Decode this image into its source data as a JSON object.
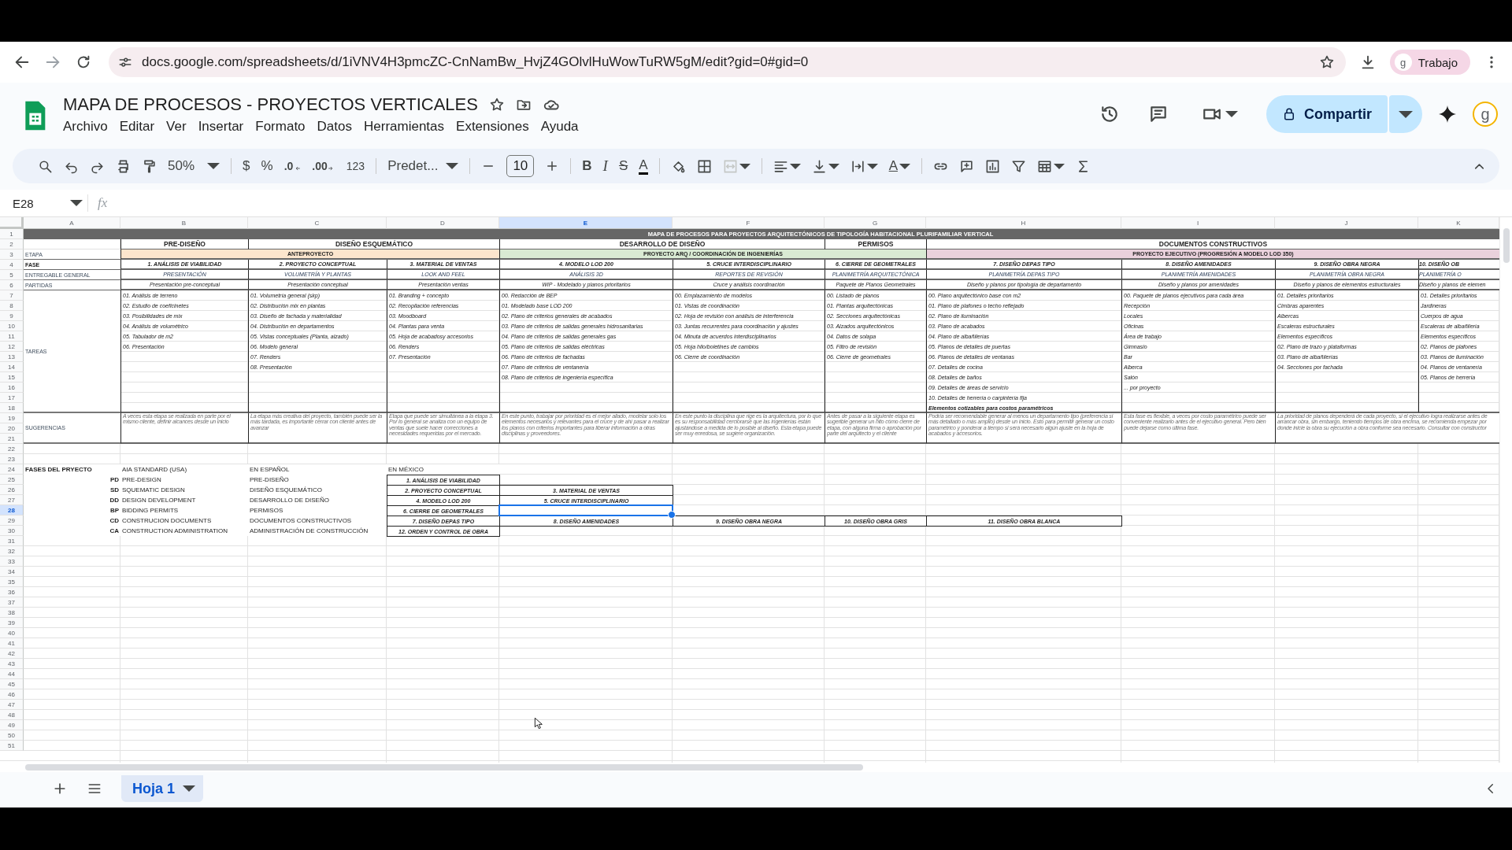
{
  "browser": {
    "url": "docs.google.com/spreadsheets/d/1iVNV4H3pmcZC-CnNamBw_HvjZ4GOlvlHuWowTuRW5gM/edit?gid=0#gid=0",
    "profile_initial": "g",
    "profile": "Trabajo"
  },
  "document": {
    "title": "MAPA DE PROCESOS - PROYECTOS VERTICALES",
    "menu": [
      "Archivo",
      "Editar",
      "Ver",
      "Insertar",
      "Formato",
      "Datos",
      "Herramientas",
      "Extensiones",
      "Ayuda"
    ],
    "share": "Compartir",
    "account_initial": "g"
  },
  "toolbar": {
    "zoom": "50%",
    "currency": "$",
    "percent": "%",
    "decrease_decimals": ".0",
    "increase_decimals": ".00",
    "number_format": "123",
    "font": "Predet...",
    "font_size": "10",
    "bold": "B",
    "italic": "I",
    "strikethrough": "S",
    "text_color": "A",
    "text_rotation": "A"
  },
  "formula_bar": {
    "cell_ref": "E28",
    "fx": "fx"
  },
  "sheet": {
    "columns": [
      {
        "label": "A",
        "selected": false
      },
      {
        "label": "B",
        "selected": false
      },
      {
        "label": "C",
        "selected": false
      },
      {
        "label": "D",
        "selected": false
      },
      {
        "label": "E",
        "selected": true
      },
      {
        "label": "F",
        "selected": false
      },
      {
        "label": "G",
        "selected": false
      },
      {
        "label": "H",
        "selected": false
      },
      {
        "label": "I",
        "selected": false
      },
      {
        "label": "J",
        "selected": false
      },
      {
        "label": "K",
        "selected": false
      }
    ],
    "rows": [
      {
        "label": "1",
        "selected": false
      },
      {
        "label": "2",
        "selected": false
      },
      {
        "label": "3",
        "selected": false
      },
      {
        "label": "4",
        "selected": false
      },
      {
        "label": "5",
        "selected": false
      },
      {
        "label": "6",
        "selected": false
      },
      {
        "label": "7",
        "selected": false
      },
      {
        "label": "8",
        "selected": false
      },
      {
        "label": "9",
        "selected": false
      },
      {
        "label": "10",
        "selected": false
      },
      {
        "label": "11",
        "selected": false
      },
      {
        "label": "12",
        "selected": false
      },
      {
        "label": "13",
        "selected": false
      },
      {
        "label": "14",
        "selected": false
      },
      {
        "label": "15",
        "selected": false
      },
      {
        "label": "16",
        "selected": false
      },
      {
        "label": "17",
        "selected": false
      },
      {
        "label": "18",
        "selected": false
      },
      {
        "label": "19",
        "selected": false
      },
      {
        "label": "20",
        "selected": false
      },
      {
        "label": "21",
        "selected": false
      },
      {
        "label": "22",
        "selected": false
      },
      {
        "label": "23",
        "selected": false
      },
      {
        "label": "24",
        "selected": false
      },
      {
        "label": "25",
        "selected": false
      },
      {
        "label": "26",
        "selected": false
      },
      {
        "label": "27",
        "selected": false
      },
      {
        "label": "28",
        "selected": true
      },
      {
        "label": "29",
        "selected": false
      },
      {
        "label": "30",
        "selected": false
      },
      {
        "label": "31",
        "selected": false
      },
      {
        "label": "32",
        "selected": false
      },
      {
        "label": "33",
        "selected": false
      },
      {
        "label": "34",
        "selected": false
      },
      {
        "label": "35",
        "selected": false
      },
      {
        "label": "36",
        "selected": false
      },
      {
        "label": "37",
        "selected": false
      },
      {
        "label": "38",
        "selected": false
      },
      {
        "label": "39",
        "selected": false
      },
      {
        "label": "40",
        "selected": false
      },
      {
        "label": "41",
        "selected": false
      },
      {
        "label": "42",
        "selected": false
      },
      {
        "label": "43",
        "selected": false
      },
      {
        "label": "44",
        "selected": false
      },
      {
        "label": "45",
        "selected": false
      },
      {
        "label": "46",
        "selected": false
      },
      {
        "label": "47",
        "selected": false
      },
      {
        "label": "48",
        "selected": false
      },
      {
        "label": "49",
        "selected": false
      },
      {
        "label": "50",
        "selected": false
      },
      {
        "label": "51",
        "selected": false
      }
    ],
    "banner": "MAPA DE PROCESOS PARA PROYECTOS ARQUITECTÓNICOS DE TIPOLOGÍA HABITACIONAL PLURIFAMILIAR VERTICAL",
    "row_labels": [
      "ETAPA",
      "FASE",
      "ENTREGABLE GENERAL",
      "PARTIDAS",
      "TAREAS",
      "SUGERENCIAS"
    ],
    "project_stages": [
      {
        "label": "ANTEPROYECTO",
        "color": "#fce5cd",
        "design_stages": [
          {
            "label": "PRE-DISEÑO",
            "phases": [
              {
                "phase": "1. ANÁLISIS DE VIABILIDAD",
                "deliverable": "PRESENTACIÓN",
                "item": "Presentación pre-conceptual",
                "tasks": [
                  "01. Análisis de terreno",
                  "02. Estudio de coeficinetes",
                  "03. Posibilidades de mix",
                  "04. Análisis de volumétrico",
                  "05. Tabulador de m2",
                  "06. Presentación"
                ],
                "suggestion": "A veces esta etapa se realizada en parte por el mismo cliente, definir alcances desde un inicio"
              }
            ]
          },
          {
            "label": "DISEÑO ESQUEMÁTICO",
            "phases": [
              {
                "phase": "2. PROYECTO CONCEPTUAL",
                "deliverable": "VOLUMETRÍA Y PLANTAS",
                "item": "Presentación conceptual",
                "tasks": [
                  "01. Volumetría general (skp)",
                  "02. Distribución mix en plantas",
                  "03. Diseño de fachada y materialidad",
                  "04. Distribución en departamentos",
                  "05. Vistas conceptuales (Planta, alzado)",
                  "06. Modelo general",
                  "07. Renders",
                  "08. Presentación"
                ],
                "suggestion": "La etapa más creativa del proyecto, también puede ser la más tardada, es importante cerrar con cliente antes de avanzar"
              },
              {
                "phase": "3. MATERIAL DE VENTAS",
                "deliverable": "LOOK AND FEEL",
                "item": "Presentación ventas",
                "tasks": [
                  "01. Branding + concepto",
                  "02. Recopilación referencias",
                  "03. Moodboard",
                  "04. Plantas para venta",
                  "05. Hoja de acabadosy accesorios",
                  "06. Renders",
                  "07. Presentación"
                ],
                "suggestion": "Etapa que puede ser simultánea a la etapa 3. Por lo general se analiza con un equipo de ventas que suele hacer correcciones a necesidades requeridas por el mercado."
              }
            ]
          }
        ]
      },
      {
        "label": "PROYECTO ARQ / COORDINACIÓN DE INGENIERÍAS",
        "color": "#d9ead3",
        "design_stages": [
          {
            "label": "DESARROLLO DE DISEÑO",
            "phases": [
              {
                "phase": "4. MODELO LOD 200",
                "deliverable": "ANÁLISIS 3D",
                "item": "WIP - Modelado y planos prioritarios",
                "tasks": [
                  "00. Redacción de BEP",
                  "01. Modelado base LOD 200",
                  "02. Plano de criterios generales de acabados",
                  "03. Plano de criterios de salidas generales hidrosanitarias",
                  "04. Plano de criterios de salidas generales gas",
                  "05. Plano de criterios de salidas eléctricas",
                  "06. Plano de criterios de fachadas",
                  "07. Plano de criterios de ventanería",
                  "08. Plano de criterios de ingeniería específica"
                ],
                "suggestion": "En este punto, trabajar por prioridad es el mejor aliado, modelar solo los elementos necesarios y relevantes para el cruce y de ahí pasar a realizar los planos con criterios importantes para liberar información a otras disciplinas y proveedores."
              },
              {
                "phase": "5. CRUCE INTERDISCIPLINARIO",
                "deliverable": "REPORTES DE REVISIÓN",
                "item": "Cruce y análisis coordinación",
                "tasks": [
                  "00. Emplazamiento de modelos",
                  "01. Vistas de coordinación",
                  "02. Hoja de revisión con análisis de interferencia",
                  "03. Juntas recurrentes para coordinación y ajustes",
                  "04. Minuta de acuerdos interdisciplinarios",
                  "05. Hoja hilo/boletines de cambios",
                  "06. Cierre de coordinación"
                ],
                "suggestion": "En este punto la disciplina que rige es la arquitectura, por lo que es su responsabilidad cerciorarse que las ingenierías están ajustándose a medida de lo posible al diseño. Esta etapa puede ser muy enredosa, se sugiere organización."
              }
            ]
          },
          {
            "label": "PERMISOS",
            "phases": [
              {
                "phase": "6. CIERRE DE GEOMETRALES",
                "deliverable": "PLANIMETRÍA ARQUITECTÓNICA",
                "item": "Paquete de Planos Geometrales",
                "tasks": [
                  "00. Listado de planos",
                  "01. Plantas arquitectónicas",
                  "02. Secciones arquitectónicas",
                  "03. Alzados arquitectónicos",
                  "04. Datos de solapa",
                  "05. Filtro de revisión",
                  "06. Cierre de geometrales"
                ],
                "suggestion": "Antes de pasar a la siguiente etapa es sugerible generar un hito cómo cierre de etapa, con alguna firma o aprobación por parte del arquitecto y el cliente"
              }
            ]
          }
        ]
      },
      {
        "label": "PROYECTO EJECUTIVO (PROGRESIÓN A MODELO LOD 350)",
        "color": "#ead1dc",
        "design_stages": [
          {
            "label": "DOCUMENTOS CONSTRUCTIVOS",
            "phases": [
              {
                "phase": "7. DISEÑO DEPAS TIPO",
                "deliverable": "PLANIMETRÍA DEPAS TIPO",
                "item": "Diseño y planos por tipología de departamento",
                "tasks": [
                  "00. Plano arquitectónico base con m2",
                  "01. Plano de plafones o techo reflejado",
                  "02. Plano de iluminación",
                  "03. Plano de acabados",
                  "04. Plano de albañilerías",
                  "05. Planos de detalles de puertas",
                  "06. Planos de detalles de ventanas",
                  "07. Detalles de cocina",
                  "08. Detalles de baños",
                  "09. Detalles de áreas de servicio",
                  "10. Detalles de herrería o carpintería fija"
                ],
                "summary": "Elementos cotizables para costos paramétricos",
                "suggestion": "Podría ser recomendable generar al menos un departamento tipo (preferencia si más detallado o más amplio) desde un inicio. Esto para permitir generar un costo paramétrico y ponderar a tiempo si será necesario algún ajuste en la hoja de acabados y accesorios."
              },
              {
                "phase": "8. DISEÑO AMENIDADES",
                "deliverable": "PLANIMETRÍA AMENIDADES",
                "item": "Diseño y planos por amenidades",
                "tasks": [
                  "00. Paquete de planos ejecutivos para cada área",
                  "Recepción",
                  "Locales",
                  "Oficinas",
                  "Área de trabajo",
                  "Gimnasio",
                  "Bar",
                  "Alberca",
                  "Salón",
                  "... por proyecto"
                ],
                "suggestion": "Esta fase es flexible, a veces por costo paramétrico puede ser conveniente realizarlo antes de el ejecutivo general. Pero bien puede dejarse como última fase."
              },
              {
                "phase": "9. DISEÑO OBRA NEGRA",
                "deliverable": "PLANIMETRÍA OBRA NEGRA",
                "item": "Diseño y planos de elementos estructurales",
                "tasks": [
                  "01. Detalles prioritarios",
                  "Cimbras aparentes",
                  "Albercas",
                  "Escaleras estructurales",
                  "Elementos específicos",
                  "02. Plano de trazo y plataformas",
                  "03. Plano de albañilerías",
                  "04. Secciones por fachada"
                ],
                "suggestion": "La prioridad de planos dependerá de cada proyecto, si el ejecutivo logra realizarse antes de arrancar obra, sin embargo, teniendo tiempos de obra encima, se recomienda empezar por donde inicie la obra su ejecución a obra conforme sea necesario. Consultar con constructor"
              },
              {
                "phase": "10. DISEÑO OB",
                "deliverable": "PLANIMETRÍA O",
                "item": "Diseño y planos de elemen",
                "tasks": [
                  "01. Detalles prioritarios",
                  "Jardineras",
                  "Cuerpos de agua",
                  "Escaleras de albañilería",
                  "Elementos específicos",
                  "02. Planos de plafones",
                  "03. Planos de iluminación",
                  "04. Planos de ventanería",
                  "05. Planos de herrería"
                ]
              }
            ]
          }
        ]
      }
    ],
    "equivalences": {
      "title": "FASES DEL PRYECTO",
      "headers": [
        "AIA STANDARD (USA)",
        "EN ESPAÑOL",
        "EN MÉXICO"
      ],
      "rows": [
        {
          "code": "PD",
          "aia": "PRE-DESIGN",
          "spanish": "PRE-DISEÑO",
          "mexico": [
            "1. ANÁLISIS DE VIABILIDAD"
          ]
        },
        {
          "code": "SD",
          "aia": "SQUEMATIC DESIGN",
          "spanish": "DISEÑO ESQUEMÁTICO",
          "mexico": [
            "2. PROYECTO CONCEPTUAL",
            "3. MATERIAL DE VENTAS"
          ]
        },
        {
          "code": "DD",
          "aia": "DESIGN DEVELOPMENT",
          "spanish": "DESARROLLO DE DISEÑO",
          "mexico": [
            "4. MODELO LOD 200",
            "5. CRUCE INTERDISCIPLINARIO"
          ]
        },
        {
          "code": "BP",
          "aia": "BIDDING PERMITS",
          "spanish": "PERMISOS",
          "mexico": [
            "6. CIERRE DE GEOMETRALES"
          ]
        },
        {
          "code": "CD",
          "aia": "CONSTRUCION DOCUMENTS",
          "spanish": "DOCUMENTOS CONSTRUCTIVOS",
          "mexico": [
            "7. DISEÑO DEPAS TIPO",
            "8. DISEÑO AMENIDADES",
            "9. DISEÑO OBRA NEGRA",
            "10. DISEÑO OBRA GRIS",
            "11. DISEÑO OBRA BLANCA"
          ]
        },
        {
          "code": "CA",
          "aia": "CONSTRUCTION ADMINISTRATION",
          "spanish": "ADMINISTRACIÓN DE CONSTRUCCIÓN",
          "mexico": [
            "12. ORDEN Y CONTROL DE OBRA"
          ]
        }
      ]
    }
  },
  "sheet_tabs": [
    {
      "label": "Hoja 1",
      "selected": true
    }
  ]
}
